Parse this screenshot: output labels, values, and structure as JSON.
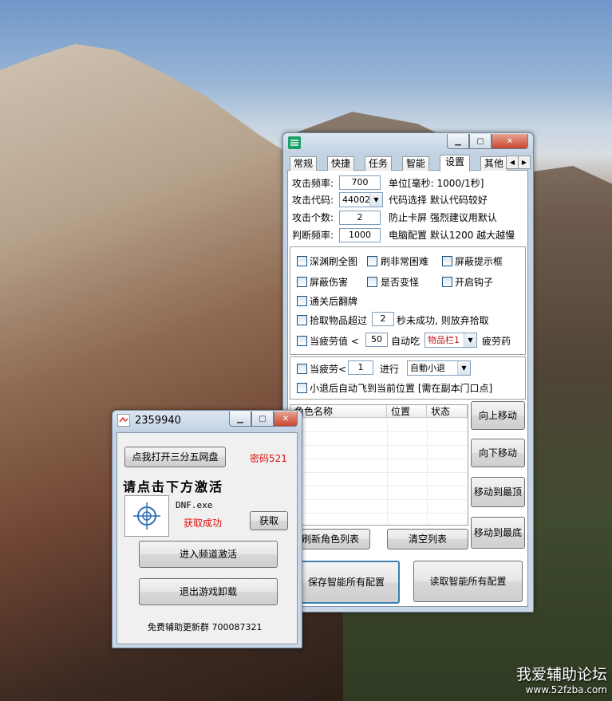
{
  "watermark": {
    "line1": "我爱辅助论坛",
    "line2": "www.52fzba.com"
  },
  "settings_window": {
    "tabs": [
      "常规",
      "快捷",
      "任务",
      "智能",
      "设置",
      "其他"
    ],
    "active_tab": "设置",
    "rows": [
      {
        "label": "攻击频率:",
        "value": "700",
        "note": "单位[毫秒: 1000/1秒]"
      },
      {
        "label": "攻击代码:",
        "value": "44002",
        "note": "代码选择  默认代码较好"
      },
      {
        "label": "攻击个数:",
        "value": "2",
        "note": "防止卡屏  强烈建议用默认"
      },
      {
        "label": "判断频率:",
        "value": "1000",
        "note": "电脑配置  默认1200  越大越慢"
      }
    ],
    "checks": {
      "deep_abyss": "深渊刷全图",
      "non_normal": "刷非常困难",
      "block_tips": "屏蔽提示框",
      "block_damage": "屏蔽伤害",
      "is_transform": "是否变怪",
      "open_hook": "开启钩子",
      "clear_flip": "通关后翻牌",
      "pickup_prefix": "拾取物品超过",
      "pickup_value": "2",
      "pickup_suffix": "秒未成功, 则放弃拾取",
      "fatigue_prefix": "当疲劳值  <",
      "fatigue_value": "50",
      "fatigue_mid": "自动吃",
      "fatigue_combo": "物品栏1",
      "fatigue_suffix": "疲劳药"
    },
    "exhaust": {
      "label": "当疲劳<",
      "value": "1",
      "mid": "进行",
      "combo": "自動小退",
      "fly_back": "小退后自动飞到当前位置  [需在副本门口点]"
    },
    "listview": {
      "headers": [
        "角色名称",
        "位置",
        "状态"
      ],
      "rows": 9
    },
    "buttons": {
      "move_up": "向上移动",
      "move_down": "向下移动",
      "move_top": "移动到最顶",
      "move_bottom": "移动到最底",
      "refresh_list": "刷新角色列表",
      "clear_list": "清空列表",
      "save_all": "保存智能所有配置",
      "load_all": "读取智能所有配置"
    }
  },
  "activation_window": {
    "title": "2359940",
    "open_disk_button": "点我打开三分五网盘",
    "password_text": "密码521",
    "heading": "请点击下方激活",
    "process_name": "DNF.exe",
    "status": "获取成功",
    "get_button": "获取",
    "enter_button": "进入频道激活",
    "exit_button": "退出游戏卸载",
    "footer": "免费辅助更新群  700087321",
    "status_color": "#e01010",
    "password_color": "#e01010"
  }
}
